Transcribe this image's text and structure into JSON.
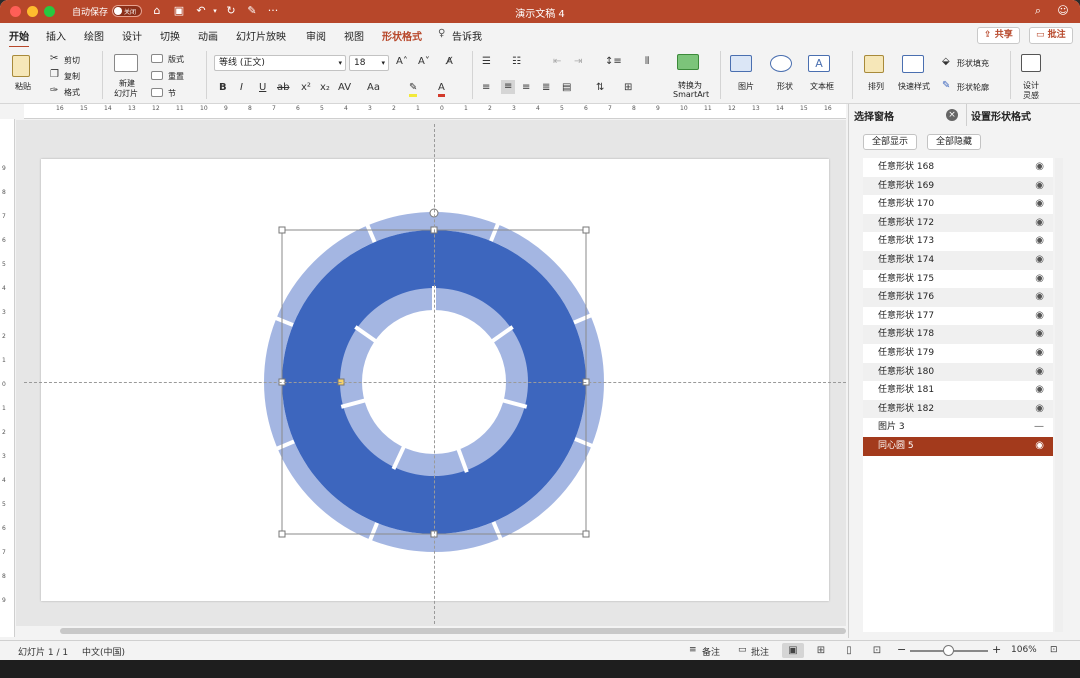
{
  "titlebar": {
    "autosave_label": "自动保存",
    "autosave_state": "关闭",
    "doc_title": "演示文稿 4",
    "quick_more": "···"
  },
  "tabs": [
    {
      "label": "开始"
    },
    {
      "label": "插入"
    },
    {
      "label": "绘图"
    },
    {
      "label": "设计"
    },
    {
      "label": "切换"
    },
    {
      "label": "动画"
    },
    {
      "label": "幻灯片放映"
    },
    {
      "label": "审阅"
    },
    {
      "label": "视图"
    },
    {
      "label": "形状格式"
    },
    {
      "label": "告诉我"
    }
  ],
  "share_label": "共享",
  "comment_label": "批注",
  "ribbon": {
    "paste": "粘贴",
    "cut": "剪切",
    "copy": "复制",
    "format_painter": "格式",
    "new_slide_1": "新建",
    "new_slide_2": "幻灯片",
    "layout": "版式",
    "reset": "重置",
    "section": "节",
    "font_name": "等线 (正文)",
    "font_size": "18",
    "convert_1": "转换为",
    "convert_2": "SmartArt",
    "picture": "图片",
    "shapes": "形状",
    "textbox": "文本框",
    "arrange": "排列",
    "quick_styles": "快速样式",
    "shape_fill": "形状填充",
    "shape_outline": "形状轮廓",
    "design_1": "设计",
    "design_2": "灵感"
  },
  "ruler": {
    "h_labels": [
      "16",
      "15",
      "14",
      "13",
      "12",
      "11",
      "10",
      "9",
      "8",
      "7",
      "6",
      "5",
      "4",
      "3",
      "2",
      "1",
      "0",
      "1",
      "2",
      "3",
      "4",
      "5",
      "6",
      "7",
      "8",
      "9",
      "10",
      "11",
      "12",
      "13",
      "14",
      "15",
      "16"
    ],
    "v_labels": [
      "9",
      "8",
      "7",
      "6",
      "5",
      "4",
      "3",
      "2",
      "1",
      "0",
      "1",
      "2",
      "3",
      "4",
      "5",
      "6",
      "7",
      "8",
      "9"
    ]
  },
  "pane": {
    "tab_selection": "选择窗格",
    "tab_format": "设置形状格式",
    "show_all": "全部显示",
    "hide_all": "全部隐藏",
    "items": [
      {
        "label": "任意形状 168",
        "visible": true
      },
      {
        "label": "任意形状 169",
        "visible": true
      },
      {
        "label": "任意形状 170",
        "visible": true
      },
      {
        "label": "任意形状 172",
        "visible": true
      },
      {
        "label": "任意形状 173",
        "visible": true
      },
      {
        "label": "任意形状 174",
        "visible": true
      },
      {
        "label": "任意形状 175",
        "visible": true
      },
      {
        "label": "任意形状 176",
        "visible": true
      },
      {
        "label": "任意形状 177",
        "visible": true
      },
      {
        "label": "任意形状 178",
        "visible": true
      },
      {
        "label": "任意形状 179",
        "visible": true
      },
      {
        "label": "任意形状 180",
        "visible": true
      },
      {
        "label": "任意形状 181",
        "visible": true
      },
      {
        "label": "任意形状 182",
        "visible": true
      },
      {
        "label": "图片 3",
        "visible": false
      },
      {
        "label": "同心圆 5",
        "visible": true,
        "selected": true
      }
    ]
  },
  "status": {
    "slide_info": "幻灯片 1 / 1",
    "language": "中文(中国)",
    "notes": "备注",
    "comments": "批注",
    "zoom": "106%"
  },
  "colors": {
    "accent": "#b7472a",
    "ring_dark": "#3d66be",
    "ring_light": "#a4b6e2",
    "selected_row": "#a33a1c"
  }
}
